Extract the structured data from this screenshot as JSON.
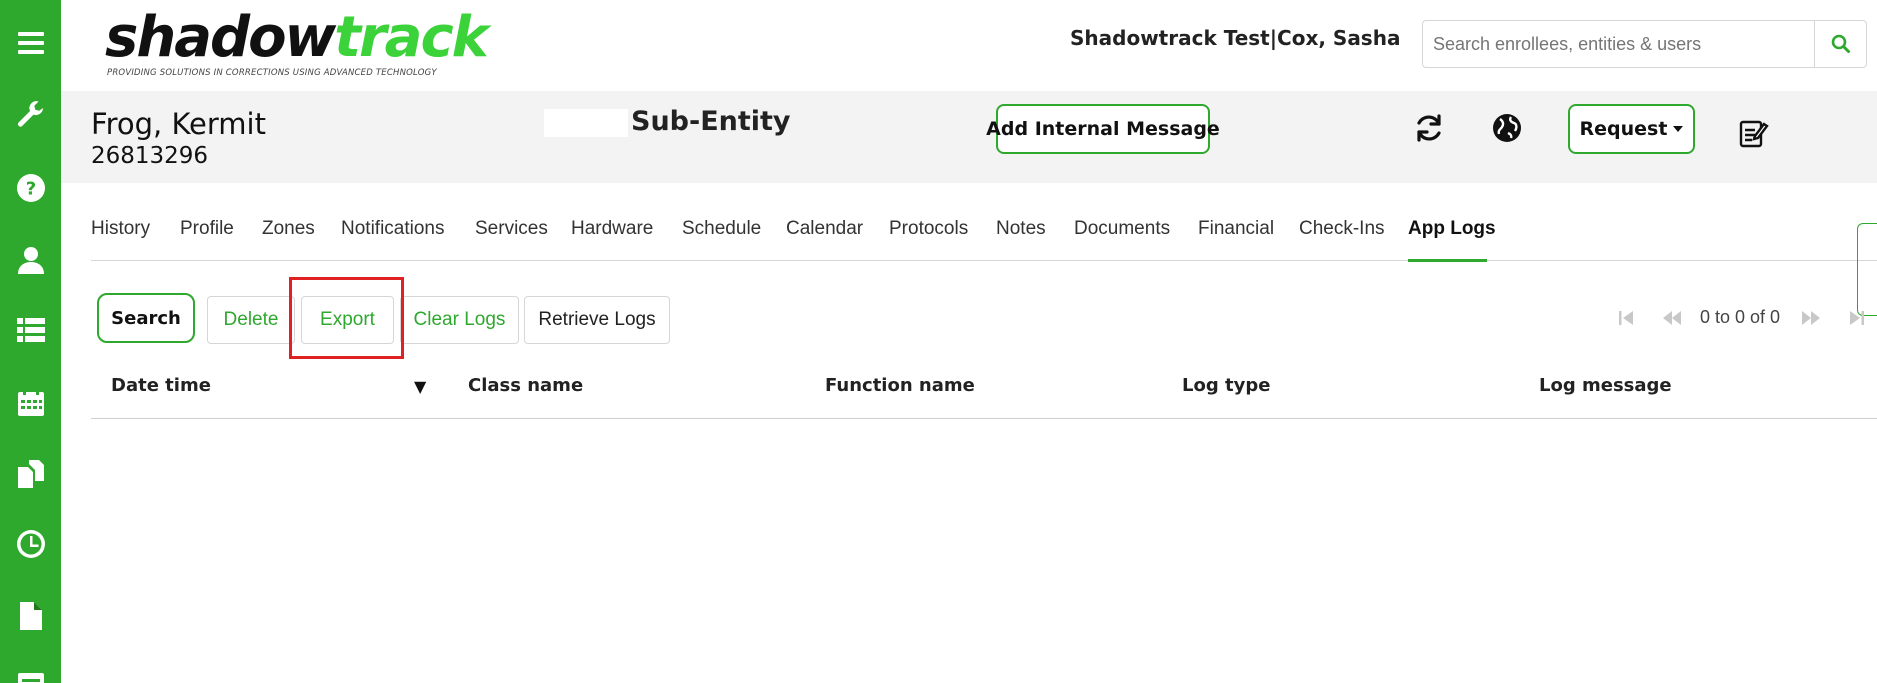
{
  "sidebar": {
    "accent_color": "#2fa82e",
    "items": [
      {
        "icon": "menu-icon"
      },
      {
        "icon": "wrench-icon"
      },
      {
        "icon": "help-icon"
      },
      {
        "icon": "user-icon"
      },
      {
        "icon": "list-icon"
      },
      {
        "icon": "calendar-icon"
      },
      {
        "icon": "documents-icon"
      },
      {
        "icon": "clock-icon"
      },
      {
        "icon": "file-icon"
      },
      {
        "icon": "report-icon"
      }
    ]
  },
  "header": {
    "logo_part1": "shadow",
    "logo_part2": "track",
    "logo_tagline": "PROVIDING SOLUTIONS IN CORRECTIONS USING ADVANCED TECHNOLOGY",
    "user_info": "Shadowtrack Test|Cox, Sasha",
    "search_placeholder": "Search enrollees, entities & users"
  },
  "enrollee": {
    "name": "Frog, Kermit",
    "id": "26813296",
    "entity": "Sub-Entity",
    "add_message_label": "Add Internal Message",
    "request_label": "Request"
  },
  "tabs": [
    {
      "label": "History"
    },
    {
      "label": "Profile"
    },
    {
      "label": "Zones"
    },
    {
      "label": "Notifications"
    },
    {
      "label": "Services"
    },
    {
      "label": "Hardware"
    },
    {
      "label": "Schedule"
    },
    {
      "label": "Calendar"
    },
    {
      "label": "Protocols"
    },
    {
      "label": "Notes"
    },
    {
      "label": "Documents"
    },
    {
      "label": "Financial"
    },
    {
      "label": "Check-Ins"
    },
    {
      "label": "App Logs",
      "active": true
    }
  ],
  "toolbar": {
    "search": "Search",
    "delete": "Delete",
    "export": "Export",
    "clear_logs": "Clear Logs",
    "retrieve_logs": "Retrieve Logs"
  },
  "pager": {
    "text": "0 to 0 of 0"
  },
  "table": {
    "columns": [
      "Date time",
      "Class name",
      "Function name",
      "Log type",
      "Log message"
    ],
    "sort_indicator": "▼",
    "rows": []
  }
}
